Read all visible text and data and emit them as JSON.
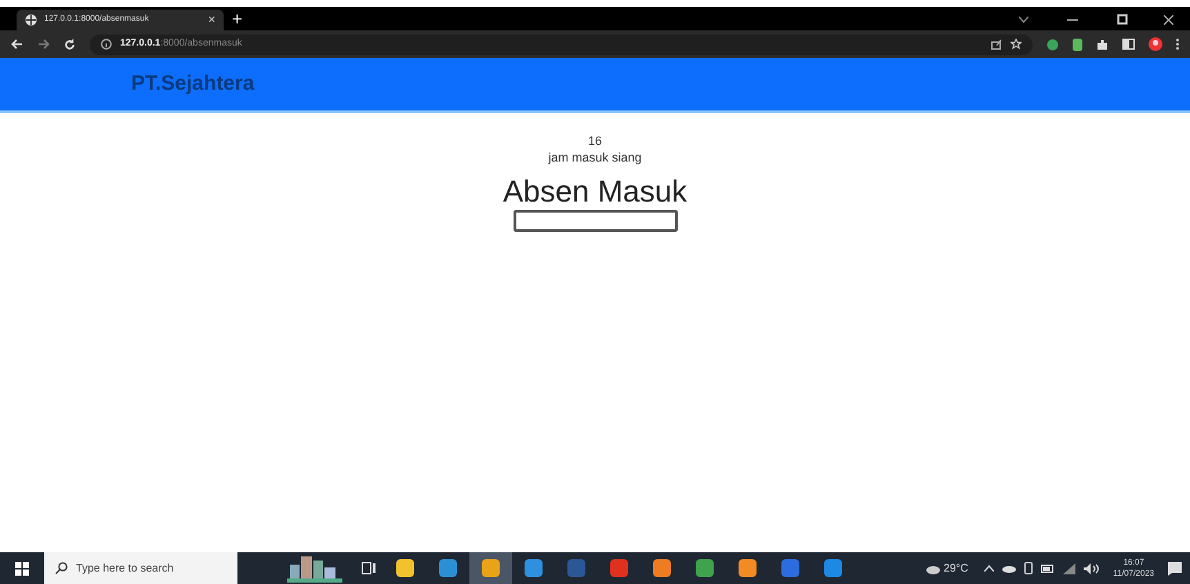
{
  "browser": {
    "tab": {
      "title": "127.0.0.1:8000/absenmasuk",
      "close": "×",
      "new_tab": "+"
    },
    "address": {
      "host": "127.0.0.1",
      "path": ":8000/absenmasuk"
    }
  },
  "navbar": {
    "brand": "PT.Sejahtera"
  },
  "content": {
    "hour": "16",
    "shift": "jam masuk siang",
    "heading": "Absen Masuk"
  },
  "taskbar": {
    "search_placeholder": "Type here to search",
    "apps": [
      {
        "color": "#f2c12e",
        "active": false
      },
      {
        "color": "#2b8fd6",
        "active": false
      },
      {
        "color": "#e8a317",
        "active": true
      },
      {
        "color": "#2f8fe0",
        "active": false
      },
      {
        "color": "#2b5797",
        "active": false
      },
      {
        "color": "#e0301e",
        "active": false
      },
      {
        "color": "#f07c21",
        "active": false
      },
      {
        "color": "#3fa34d",
        "active": false
      },
      {
        "color": "#f28b22",
        "active": false
      },
      {
        "color": "#2d6cdf",
        "active": false
      },
      {
        "color": "#1e88e5",
        "active": false
      }
    ],
    "weather": "29°C",
    "time": "16:07",
    "date": "11/07/2023"
  }
}
